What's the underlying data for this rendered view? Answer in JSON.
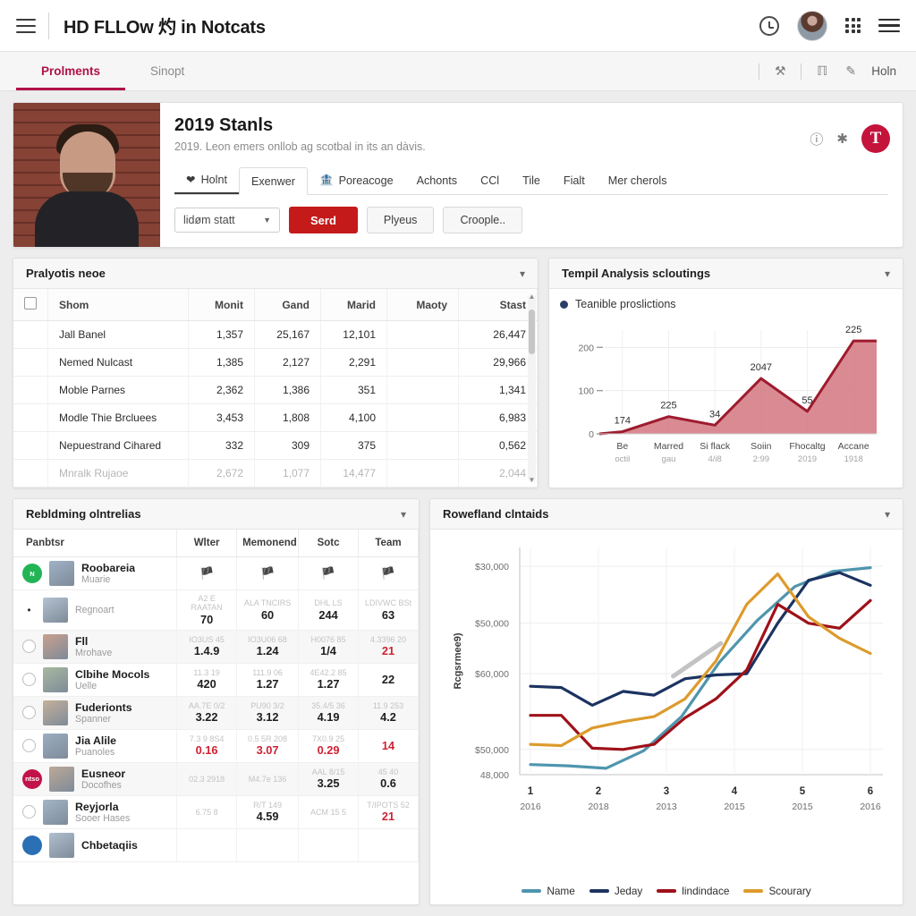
{
  "topbar": {
    "title": "HD FLLOw 灼 in Notcats",
    "icons": [
      "menu-hamburger-icon",
      "clock-icon",
      "user-avatar",
      "apps-grid-icon",
      "more-menu-icon"
    ]
  },
  "tabstrip": {
    "tabs": [
      {
        "label": "Prolments",
        "active": true
      },
      {
        "label": "Sinopt",
        "active": false
      }
    ],
    "right_icons": [
      "wrench-icon",
      "pin-icon",
      "pencil-icon"
    ],
    "right_label": "Holn"
  },
  "hero": {
    "title": "2019 Stanls",
    "subtitle": "2019. Leon emers onllob ag scotbal in its an dàvis.",
    "action_icons": [
      "info-icon",
      "asterisk-icon"
    ],
    "badge": "T",
    "tabs": [
      {
        "label": "Holnt",
        "icon": "heart-icon",
        "style": "underline"
      },
      {
        "label": "Exenwer",
        "icon": "",
        "style": "boxed"
      },
      {
        "label": "Poreacoge",
        "icon": "bank-icon",
        "style": "plain"
      },
      {
        "label": "Achonts",
        "icon": "",
        "style": "plain"
      },
      {
        "label": "CCl",
        "icon": "",
        "style": "plain"
      },
      {
        "label": "Tile",
        "icon": "",
        "style": "plain"
      },
      {
        "label": "Fialt",
        "icon": "",
        "style": "plain"
      },
      {
        "label": "Mer cherols",
        "icon": "",
        "style": "plain"
      }
    ],
    "select_value": "lidøm statt",
    "primary_button": "Serd",
    "ghost_buttons": [
      "Plyeus",
      "Croople.."
    ]
  },
  "players_panel": {
    "title": "Pralyotis neoe",
    "columns": [
      "",
      "Shom",
      "Monit",
      "Gand",
      "Marid",
      "Maoty",
      "Stast"
    ],
    "rows": [
      {
        "icon_color": "#3a3a3a",
        "name": "Jall Banel",
        "monit": "1,357",
        "gand": "25,167",
        "marid": "12,101",
        "maoty": "",
        "stast": "26,447"
      },
      {
        "icon_color": "#f2d01c",
        "name": "Nemed Nulcast",
        "monit": "1,385",
        "gand": "2,127",
        "marid": "2,291",
        "maoty": "",
        "stast": "29,966"
      },
      {
        "icon_color": "#f6e6cf",
        "name": "Moble Parnes",
        "monit": "2,362",
        "gand": "1,386",
        "marid": "351",
        "maoty": "",
        "stast": "1,341"
      },
      {
        "icon_color": "#f0d915",
        "name": "Modle Thie Brcluees",
        "monit": "3,453",
        "gand": "1,808",
        "marid": "4,100",
        "maoty": "",
        "stast": "6,983"
      },
      {
        "icon_color": "#d12c3a",
        "name": "Nepuestrand Cihared",
        "monit": "332",
        "gand": "309",
        "marid": "375",
        "maoty": "",
        "stast": "0,562"
      },
      {
        "icon_color": "#c4928a",
        "name": "Mnralk Rujaoe",
        "monit": "2,672",
        "gand": "1,077",
        "marid": "14,477",
        "maoty": "",
        "stast": "2,044"
      }
    ]
  },
  "area_panel": {
    "title": "Tempil Analysis scloutings",
    "legend": "Teanible proslictions"
  },
  "rebuilding_panel": {
    "title": "Rebldming olntrelias",
    "columns": [
      "Panbtsr",
      "Wlter",
      "Memonend",
      "Sotc",
      "Team"
    ],
    "rows": [
      {
        "status": "green",
        "badge": "N",
        "name": "Roobareia",
        "sub": "Muarie",
        "c1": "flag",
        "c2": "flag",
        "c3": "flag",
        "c4": "flag",
        "tiny1": "",
        "tiny2": "",
        "tiny3": "",
        "tiny4": ""
      },
      {
        "status": "dot",
        "badge": "",
        "name": "",
        "sub": "Regnoart",
        "c1": "70",
        "c2": "60",
        "c3": "244",
        "c4": "63",
        "tiny1": "A2 E RAATAN",
        "tiny2": "ALA TNCIRS",
        "tiny3": "DHL LS",
        "tiny4": "LDIVWC BSt"
      },
      {
        "status": "radio",
        "badge": "",
        "name": "Fll",
        "sub": "Mrohave",
        "c1": "1.4.9",
        "c2": "1.24",
        "c3": "1/4",
        "c4": "21",
        "tiny1": "IO3US 45",
        "tiny2": "IO3U06 68",
        "tiny3": "H0076 85",
        "tiny4": "4.3396 20",
        "c4red": true
      },
      {
        "status": "radio",
        "badge": "",
        "name": "Clbihe Mocols",
        "sub": "Uelle",
        "c1": "420",
        "c2": "1.27",
        "c3": "1.27",
        "c4": "22",
        "tiny1": "11.3 19",
        "tiny2": "111.9 06",
        "tiny3": "4E42.2 85",
        "tiny4": ""
      },
      {
        "status": "radio",
        "badge": "",
        "name": "Fuderionts",
        "sub": "Spanner",
        "c1": "3.22",
        "c2": "3.12",
        "c3": "4.19",
        "c4": "4.2",
        "tiny1": "AA.7E 0/2",
        "tiny2": "PU90 3/2",
        "tiny3": "35.4/5 36",
        "tiny4": "11.9 253"
      },
      {
        "status": "radio",
        "badge": "",
        "name": "Jia Alile",
        "sub": "Puanoles",
        "c1": "0.16",
        "c2": "3.07",
        "c3": "0.29",
        "c4": "14",
        "tiny1": "7.3 9 8S4",
        "tiny2": "0.5 5R 208",
        "tiny3": "7X0.9 25",
        "tiny4": "",
        "allred": true
      },
      {
        "status": "red",
        "badge": "ntso",
        "name": "Eusneor",
        "sub": "Docofhes",
        "c1": "",
        "c2": "",
        "c3": "3.25",
        "c4": "0.6",
        "tiny1": "02.3 2918",
        "tiny2": "M4.7e 136",
        "tiny3": "AAL 8/15",
        "tiny4": "45 40"
      },
      {
        "status": "radio",
        "badge": "",
        "name": "Reyjorla",
        "sub": "Sooer Hases",
        "c1": "",
        "c2": "4.59",
        "c3": "",
        "c4": "21",
        "tiny1": "6.75 8",
        "tiny2": "R/T 149",
        "tiny3": "ACM 15 5",
        "tiny4": "T/IPOTS 52",
        "c4red": true
      },
      {
        "status": "blue",
        "badge": "",
        "name": "Chbetaqiis",
        "sub": "",
        "c1": "",
        "c2": "",
        "c3": "",
        "c4": "",
        "tiny1": "",
        "tiny2": "",
        "tiny3": "",
        "tiny4": ""
      }
    ]
  },
  "lines_panel": {
    "title": "Rowefland clntaids"
  },
  "colors": {
    "accent_crimson": "#b01245",
    "primary_red": "#c41a1a",
    "badge_red": "#c4143c",
    "area_fill": "#d2707a",
    "area_stroke": "#9e1b2e",
    "line_name": "#4f95ad",
    "line_jeday": "#1c3361",
    "line_lindindace": "#9e1119",
    "line_scourary": "#dd9b2d"
  },
  "chart_data": [
    {
      "type": "area",
      "title": "Tempil Analysis scloutings",
      "legend": [
        "Teanible proslictions"
      ],
      "categories": [
        "Be octil",
        "Marred gau",
        "Si flack 4/i8",
        "Soiin 2:99",
        "Fhocaltg 2019",
        "Accane 1918"
      ],
      "xtick_lines": [
        [
          "Be",
          "octil"
        ],
        [
          "Marred",
          "gau"
        ],
        [
          "Si flack",
          "4/i8"
        ],
        [
          "Soiin",
          "2:99"
        ],
        [
          "Fhocaltg",
          "2019"
        ],
        [
          "Accane",
          "1918"
        ]
      ],
      "values": [
        5,
        40,
        20,
        128,
        52,
        215
      ],
      "point_labels": [
        "174",
        "225",
        "34",
        "2047",
        "55",
        "225"
      ],
      "ylabel": "",
      "xlabel": "",
      "yticks": [
        0,
        100,
        200
      ],
      "ylim": [
        0,
        240
      ],
      "grid": true,
      "legend_position": "top-left"
    },
    {
      "type": "line",
      "title": "Rowefland clntaids",
      "ylabel": "Rcgsrmee9)",
      "xlabel": "",
      "categories": [
        "1",
        "2",
        "3",
        "4",
        "5",
        "6"
      ],
      "xtick_sub": [
        "2016",
        "2018",
        "2013",
        "2015",
        "2015",
        "2016"
      ],
      "yticks": [
        "48,000",
        "$50,000",
        "$60,000",
        "$50,000",
        "$30,000"
      ],
      "ytick_values": [
        48000,
        50000,
        60000,
        50000,
        30000
      ],
      "ylim": [
        48000,
        30000
      ],
      "grid": true,
      "legend_position": "bottom",
      "series": [
        {
          "name": "Name",
          "color": "#4f95ad",
          "values": [
            48800,
            48700,
            48500,
            49900,
            52600,
            56900,
            60200,
            62900,
            64100,
            64400
          ]
        },
        {
          "name": "Jeday",
          "color": "#1c3361",
          "values": [
            55000,
            54900,
            53500,
            54600,
            54300,
            55600,
            55900,
            56000,
            60000,
            63400,
            64000,
            63000
          ]
        },
        {
          "name": "lindindace",
          "color": "#9e1119",
          "values": [
            52700,
            52700,
            50100,
            50000,
            50400,
            52500,
            54000,
            56300,
            61500,
            60000,
            59600,
            61800
          ]
        },
        {
          "name": "Scourary",
          "color": "#dd9b2d",
          "values": [
            50400,
            50300,
            51700,
            52200,
            52600,
            54000,
            57000,
            61500,
            63900,
            60500,
            58800,
            57600
          ]
        }
      ]
    }
  ]
}
